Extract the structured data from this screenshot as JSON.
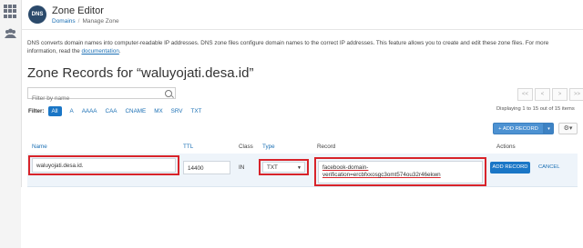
{
  "app": {
    "icon_text": "DNS",
    "title": "Zone Editor",
    "breadcrumb": [
      "Domains",
      "Manage Zone"
    ]
  },
  "description": {
    "text": "DNS converts domain names into computer-readable IP addresses. DNS zone files configure domain names to the correct IP addresses. This feature allows you to create and edit these zone files. For more information, read the ",
    "link": "documentation"
  },
  "heading": "Zone Records for “waluyojati.desa.id”",
  "search": {
    "placeholder": "Filter by name"
  },
  "pager": [
    "<<",
    "<",
    ">",
    ">>"
  ],
  "filter": {
    "label": "Filter:",
    "chips": [
      "All",
      "A",
      "AAAA",
      "CAA",
      "CNAME",
      "MX",
      "SRV",
      "TXT"
    ],
    "active": "All"
  },
  "range_text": "Displaying 1 to 15 out of 15 items",
  "toolbar": {
    "add_record": "+ ADD RECORD",
    "caret": "▾",
    "gear": "⚙▾"
  },
  "columns": {
    "name": "Name",
    "ttl": "TTL",
    "class": "Class",
    "type": "Type",
    "record": "Record",
    "actions": "Actions"
  },
  "edit_row": {
    "name": "waluyojati.desa.id.",
    "ttl": "14400",
    "class": "IN",
    "type": "TXT",
    "record_line1": "facebook-domain-",
    "record_line2": "verification=ercbfxxosgc3omt574ou32r46ekwn",
    "save": "ADD RECORD",
    "cancel": "CANCEL"
  },
  "colors": {
    "accent": "#1a76c6",
    "highlight": "#d8232a",
    "row_bg": "#eef4fa"
  }
}
